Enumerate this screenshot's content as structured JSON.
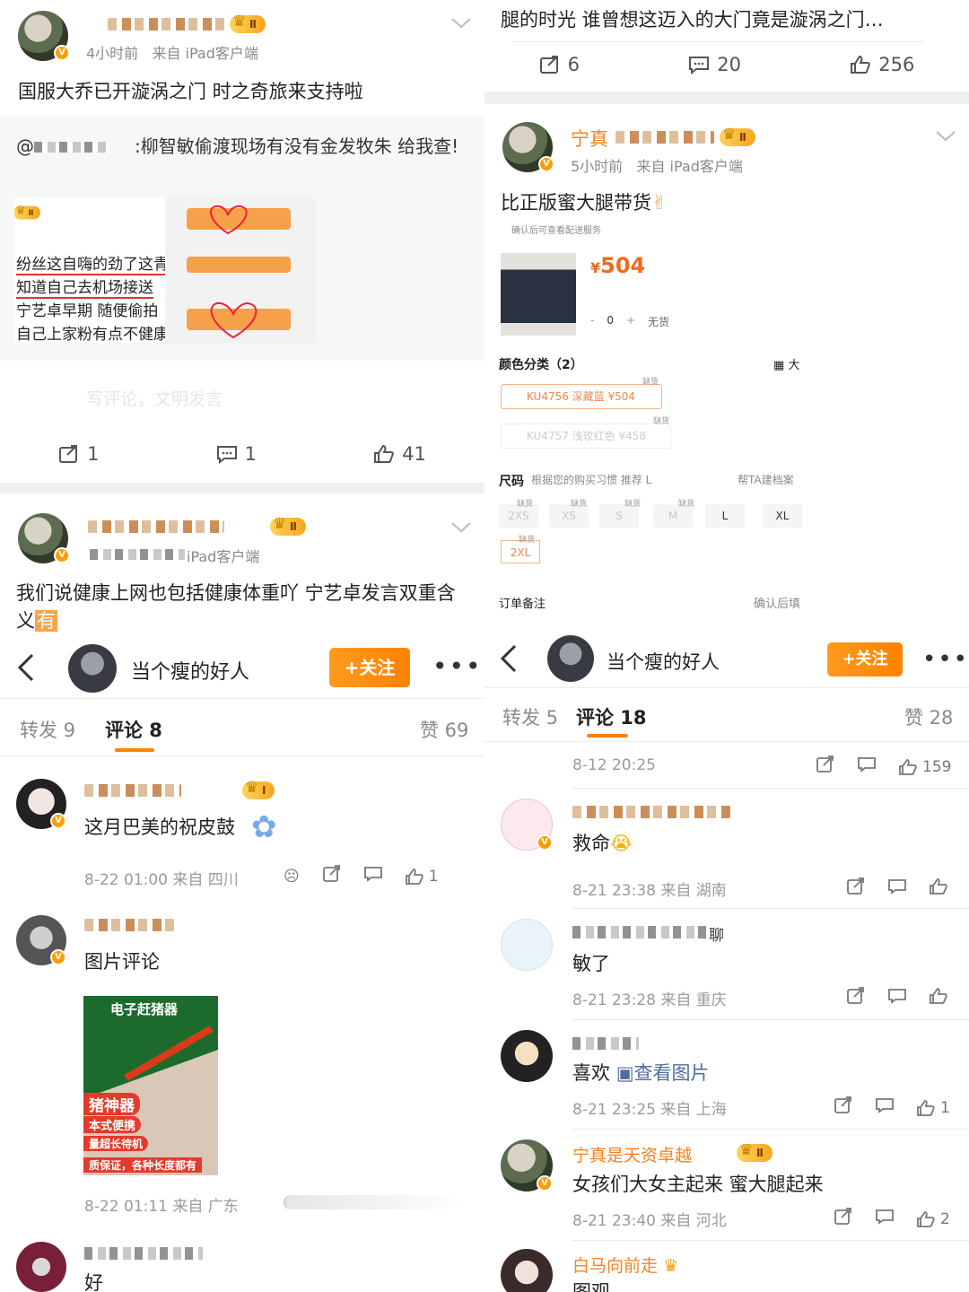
{
  "left_top_post": {
    "meta_time": "4小时前",
    "meta_source": "来自 iPad客户端",
    "body_text": "国服大乔已开漩涡之门 时之奇旅来支持啦",
    "repost_text": "@",
    "repost_text_2": ":柳智敏偷渡现场有没有金发牧朱 给我查!",
    "repost_image_lines": [
      "纷丝这自嗨的劲了这青",
      "知道自己去机场接送",
      "宁艺卓早期 随便偷拍",
      "自己上家粉有点不健康"
    ],
    "comment_placeholder": "写评论，文明发言",
    "actions": {
      "repost": "1",
      "comment": "1",
      "like": "41"
    }
  },
  "left_second_post": {
    "meta_source": "iPad客户端",
    "body_text": "我们说健康上网也包括健康体重吖 宁艺卓发言双重含义",
    "highlight": "有"
  },
  "left_detail": {
    "back_icon": "chevron-left-icon",
    "header_title": "当个瘦的好人",
    "follow_label": "+关注",
    "more_icon": "more-icon",
    "tabs": {
      "repost": "转发 9",
      "comment": "评论 8",
      "like": "赞 69"
    },
    "comments": [
      {
        "text": "这月巴美的祝皮鼓",
        "meta": "8-22 01:00  来自 四川",
        "likes": "1"
      },
      {
        "text": "图片评论",
        "meta": "8-22 01:11  来自 广东",
        "image_title": "电子赶猪器",
        "image_lines": [
          "猪神器",
          "本式便携",
          "量超长待机",
          "质保证，各种长度都有"
        ]
      },
      {
        "text": "好"
      }
    ]
  },
  "right_top_post": {
    "body_text": "腿的时光 谁曾想这迈入的大门竟是漩涡之门…",
    "actions": {
      "repost": "6",
      "comment": "20",
      "like": "256"
    }
  },
  "right_second_post": {
    "name": "宁真",
    "meta_time": "5小时前",
    "meta_source": "来自 iPad客户端",
    "body_text": "比正版蜜大腿带货",
    "shop": {
      "top_note": "确认后可查看配送服务",
      "price": "504",
      "currency": "¥",
      "qty": "0",
      "stock": "无货",
      "color_label": "颜色分类（2）",
      "grid_label": "大",
      "skus": [
        "KU4756 深藏蓝  ¥504",
        "KU4757 浅玫红色  ¥458"
      ],
      "sku_tag": "缺货",
      "size_label": "尺码",
      "size_hint": "根据您的购买习惯 推荐 L",
      "size_help": "帮TA建档案",
      "sizes": [
        "2XS",
        "XS",
        "S",
        "M",
        "L",
        "XL",
        "2XL"
      ],
      "order_note": "订单备注",
      "order_note_right": "确认后填"
    }
  },
  "right_detail": {
    "header_title": "当个瘦的好人",
    "follow_label": "+关注",
    "tabs": {
      "repost": "转发 5",
      "comment": "评论 18",
      "like": "赞 28"
    },
    "top_meta": "8-12 20:25",
    "top_likes": "159",
    "comments": [
      {
        "text": "救命",
        "meta": "8-21 23:38  来自 湖南",
        "likes": ""
      },
      {
        "text": "敏了",
        "name_tail": "聊",
        "meta": "8-21 23:28  来自 重庆",
        "likes": ""
      },
      {
        "text": "喜欢",
        "link": "查看图片",
        "meta": "8-21 23:25  来自 上海",
        "likes": "1"
      },
      {
        "name": "宁真是天资卓越",
        "text": "女孩们大女主起来 蜜大腿起来",
        "meta": "8-21 23:40  来自 河北",
        "likes": "2"
      },
      {
        "name": "白马向前走",
        "text": "图观"
      }
    ]
  },
  "colors": {
    "accent": "#ff8200",
    "name_orange": "#f58220",
    "gray": "#8a8a8a"
  }
}
